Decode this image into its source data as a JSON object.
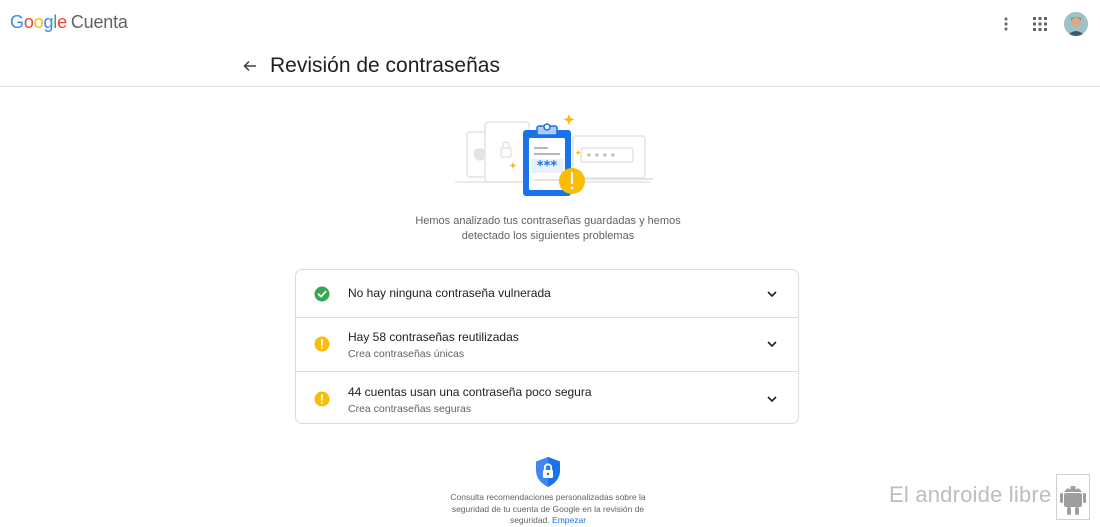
{
  "app": {
    "brand_g": "G",
    "brand_o1": "o",
    "brand_o2": "o",
    "brand_g2": "g",
    "brand_l": "l",
    "brand_e": "e",
    "product": "Cuenta"
  },
  "header": {
    "title": "Revisión de contraseñas"
  },
  "intro": {
    "line1": "Hemos analizado tus contraseñas guardadas y hemos",
    "line2": "detectado los siguientes problemas"
  },
  "checks": [
    {
      "title": "No hay ninguna contraseña vulnerada",
      "subtitle": "",
      "status": "ok"
    },
    {
      "title": "Hay 58 contraseñas reutilizadas",
      "subtitle": "Crea contraseñas únicas",
      "status": "warning"
    },
    {
      "title": "44 cuentas usan una contraseña poco segura",
      "subtitle": "Crea contraseñas seguras",
      "status": "warning"
    }
  ],
  "footer": {
    "line1": "Consulta recomendaciones personalizadas sobre la",
    "line2": "seguridad de tu cuenta de Google en la revisión de",
    "line3": "seguridad.",
    "link": "Empezar"
  },
  "watermark": {
    "text": "El androide libre"
  },
  "colors": {
    "ok": "#34A853",
    "warning": "#FBBC04",
    "accent": "#1a73e8",
    "border": "#dadce0"
  },
  "icons": {
    "more": "more-vert-icon",
    "apps": "apps-grid-icon",
    "back": "arrow-back-icon",
    "expand": "chevron-down-icon",
    "ok": "check-circle-icon",
    "warning": "warning-circle-icon",
    "shield": "shield-lock-icon"
  }
}
